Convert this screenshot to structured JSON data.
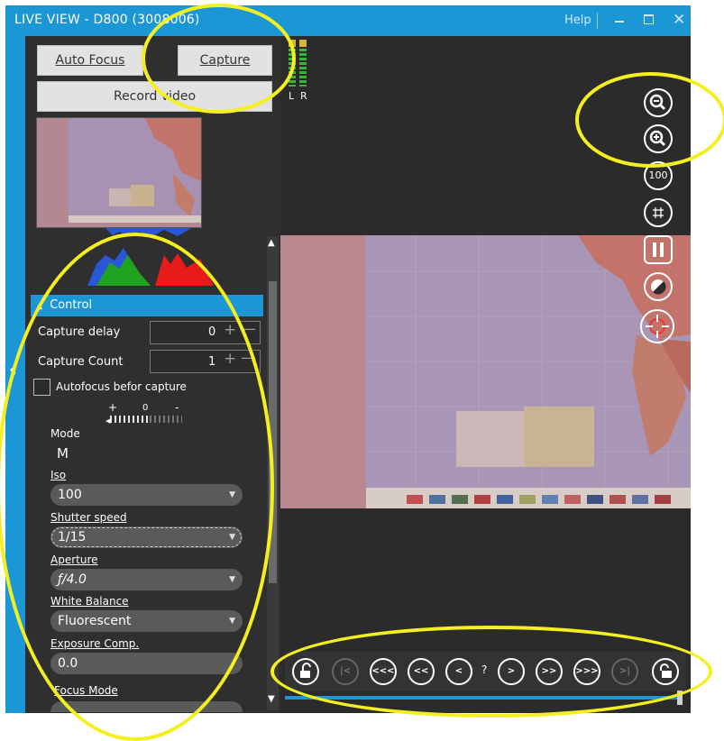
{
  "window": {
    "title": "LIVE VIEW - D800 (3008006)",
    "help": "Help",
    "accent": "#1c97d6"
  },
  "buttons": {
    "autofocus": "Auto Focus",
    "capture": "Capture",
    "record": "Record video"
  },
  "audio": {
    "left": "L",
    "right": "R"
  },
  "control": {
    "header": "Control",
    "capture_delay_label": "Capture delay",
    "capture_delay_value": "0",
    "capture_count_label": "Capture Count",
    "capture_count_value": "1",
    "autofocus_label": "Autofocus befor capture",
    "scale_plus": "+",
    "scale_zero": "0",
    "scale_minus": "-",
    "mode_label": "Mode",
    "mode_value": "M",
    "iso_label": "Iso",
    "iso_value": "100",
    "shutter_label": "Shutter speed",
    "shutter_value": "1/15",
    "aperture_label": "Aperture",
    "aperture_value": "ƒ/4.0",
    "wb_label": "White Balance",
    "wb_value": "Fluorescent",
    "exp_label": "Exposure Comp.",
    "exp_value": "0.0",
    "focus_label": "Focus Mode"
  },
  "tools": {
    "zoom_out": "zoom-out-icon",
    "zoom_in": "zoom-in-icon",
    "zoom_100": "100",
    "grid": "grid-icon",
    "pause": "pause-icon",
    "contrast": "contrast-icon",
    "focus": "focus-target-icon"
  },
  "nav": {
    "first": "|<",
    "back3": "<<<",
    "back2": "<<",
    "back1": "<",
    "mid": "?",
    "fwd1": ">",
    "fwd2": ">>",
    "fwd3": ">>>",
    "last": ">|"
  }
}
